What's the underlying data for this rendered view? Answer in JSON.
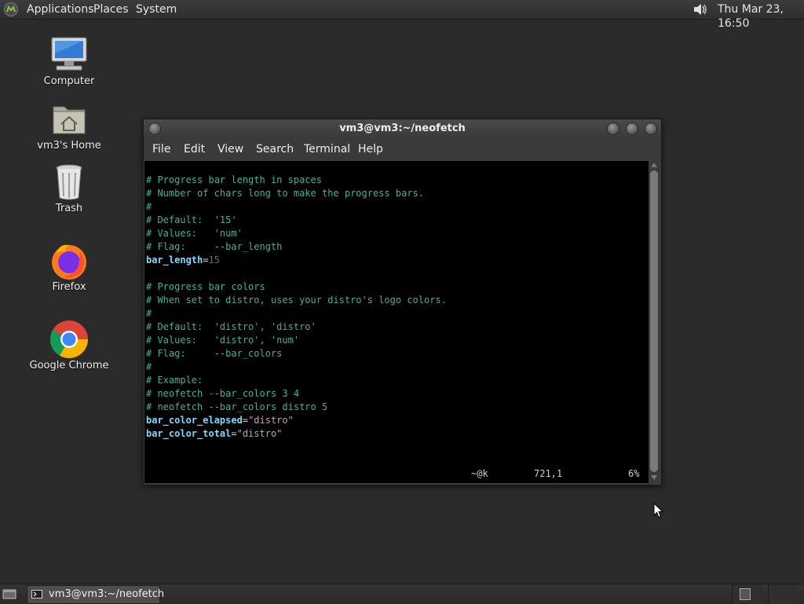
{
  "top_panel": {
    "menus": [
      "Applications",
      "Places",
      "System"
    ],
    "clock": "Thu Mar 23, 16:50",
    "logo_icon": "mate-logo-icon",
    "volume_icon": "speaker-icon"
  },
  "desktop_icons": [
    {
      "label": "Computer",
      "icon": "computer-icon"
    },
    {
      "label": "vm3's Home",
      "icon": "home-folder-icon"
    },
    {
      "label": "Trash",
      "icon": "trash-icon"
    },
    {
      "label": "Firefox",
      "icon": "firefox-icon"
    },
    {
      "label": "Google Chrome",
      "icon": "chrome-icon"
    }
  ],
  "window": {
    "title": "vm3@vm3:~/neofetch",
    "menus": [
      "File",
      "Edit",
      "View",
      "Search",
      "Terminal",
      "Help"
    ]
  },
  "terminal": {
    "lines": [
      {
        "comment": "# Progress bar length in spaces"
      },
      {
        "comment": "# Number of chars long to make the progress bars."
      },
      {
        "comment": "#"
      },
      {
        "comment": "# Default:  '15'"
      },
      {
        "comment": "# Values:   'num'"
      },
      {
        "comment": "# Flag:     --bar_length"
      },
      {
        "key": "bar_length",
        "eq": "=",
        "value": "15"
      },
      {
        "comment": ""
      },
      {
        "comment": "# Progress bar colors"
      },
      {
        "comment": "# When set to distro, uses your distro's logo colors."
      },
      {
        "comment": "#"
      },
      {
        "comment": "# Default:  'distro', 'distro'"
      },
      {
        "comment": "# Values:   'distro', 'num'"
      },
      {
        "comment": "# Flag:     --bar_colors"
      },
      {
        "comment": "#"
      },
      {
        "comment": "# Example:"
      },
      {
        "comment": "# neofetch --bar_colors 3 4"
      },
      {
        "comment": "# neofetch --bar_colors distro 5"
      },
      {
        "key": "bar_color_elapsed",
        "eq": "=",
        "value": "\"distro\""
      },
      {
        "key": "bar_color_total",
        "eq": "=",
        "value": "\"distro\""
      }
    ],
    "status": {
      "keys": "~@k",
      "position": "721,1",
      "percent": "6%"
    }
  },
  "bottom_panel": {
    "task_label": "vm3@vm3:~/neofetch",
    "task_icon": "terminal-icon",
    "show_desktop_icon": "show-desktop-icon"
  },
  "colors": {
    "comment": "#3fb39a",
    "key": "#7fd8ff",
    "string": "#c7a3a3",
    "number": "#6b6b6b",
    "terminal_bg": "#000000",
    "desktop_bg": "#2b2b2b"
  }
}
